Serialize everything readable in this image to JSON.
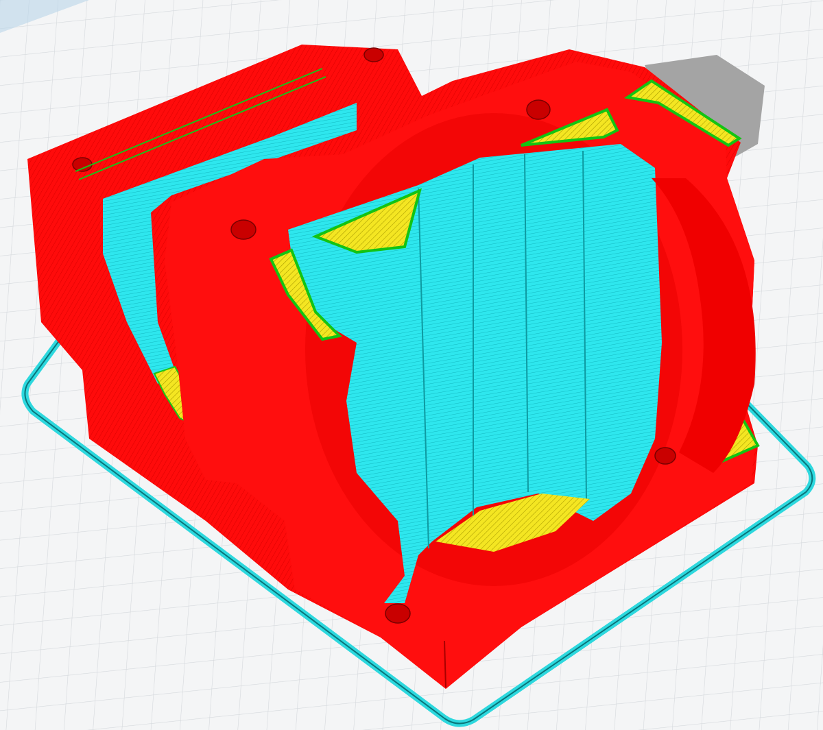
{
  "app": {
    "view": "layer-preview-3d"
  },
  "colors": {
    "build_plate": "#f4f5f6",
    "grid_line": "#d2d6da",
    "plate_edge_shadow": "#a9c8df",
    "wall_outer": "#ff0a0a",
    "wall_inner": "#1ec81e",
    "infill": "#f2e321",
    "support": "#27e6ec",
    "skirt": "#27d6dc",
    "shadow_gray": "#a3a3a3"
  },
  "legend_features": [
    "wall-outer",
    "wall-inner",
    "infill",
    "support",
    "skirt-brim"
  ]
}
